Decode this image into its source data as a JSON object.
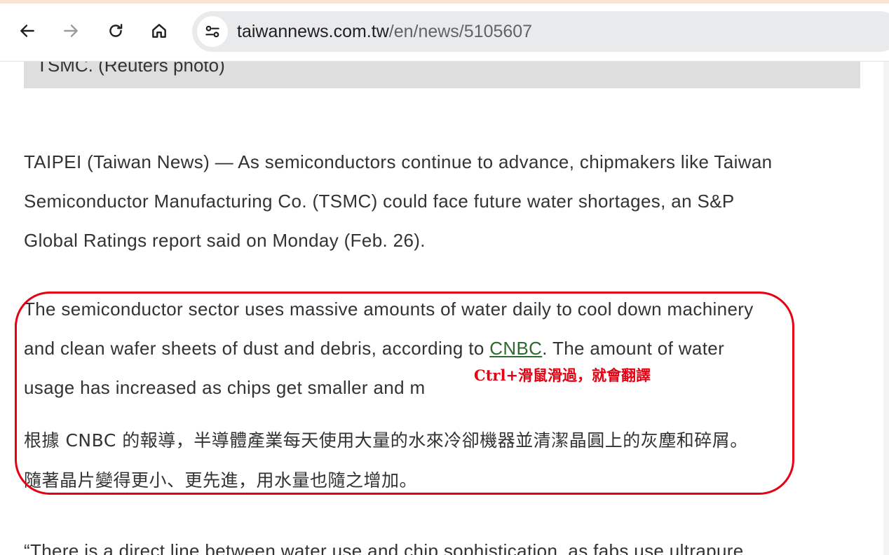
{
  "browser": {
    "url_domain": "taiwannews.com.tw",
    "url_path": "/en/news/5105607",
    "icons": {
      "back": "arrow-left-icon",
      "forward": "arrow-right-icon",
      "reload": "reload-icon",
      "home": "home-icon",
      "site_info": "tune-icon"
    }
  },
  "article": {
    "image_caption": "TSMC. (Reuters photo)",
    "paragraph1": [
      "TAIPEI (Taiwan News) — As semiconductors continue to advance, chipmakers like Taiwan",
      "Semiconductor Manufacturing Co. (TSMC) could face future water shortages, an S&P",
      "Global Ratings report said on Monday (Feb. 26)."
    ],
    "paragraph2": {
      "line1": "The semiconductor sector uses massive amounts of water daily to cool down machinery",
      "line2_before_link": "and clean wafer sheets of dust and debris, according to ",
      "link_text": "CNBC",
      "line2_after_link": ". The amount of water",
      "line3": "usage has increased as chips get smaller and m"
    },
    "translation": [
      "根據 CNBC 的報導，半導體產業每天使用大量的水來冷卻機器並清潔晶圓上的灰塵和碎屑。",
      "隨著晶片變得更小、更先進，用水量也隨之增加。"
    ],
    "paragraph3_partial": "“There is a direct line between water use and chip sophistication, as fabs use ultrapure"
  },
  "annotation": {
    "text": "Ctrl+滑鼠滑過，就會翻譯",
    "color": "#e60012"
  }
}
